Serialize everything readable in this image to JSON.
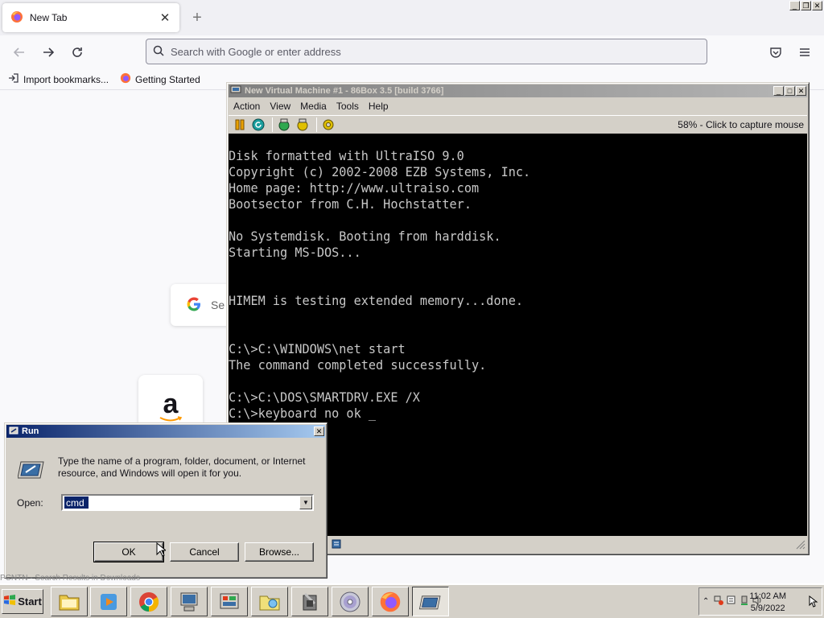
{
  "browser": {
    "tab_title": "New Tab",
    "url_placeholder": "Search with Google or enter address",
    "bookmarks": [
      "Import bookmarks...",
      "Getting Started"
    ],
    "google_partial": "Se",
    "amazon_letter": "a"
  },
  "vm": {
    "title": "New Virtual Machine #1 - 86Box 3.5 [build 3766]",
    "menus": [
      "Action",
      "View",
      "Media",
      "Tools",
      "Help"
    ],
    "capture_text": "58% - Click to capture mouse",
    "screen_lines": [
      "Disk formatted with UltraISO 9.0",
      "Copyright (c) 2002-2008 EZB Systems, Inc.",
      "Home page: http://www.ultraiso.com",
      "Bootsector from C.H. Hochstatter.",
      "",
      "No Systemdisk. Booting from harddisk.",
      "Starting MS-DOS...",
      "",
      "",
      "HIMEM is testing extended memory...done.",
      "",
      "",
      "C:\\>C:\\WINDOWS\\net start",
      "The command completed successfully.",
      "",
      "C:\\>C:\\DOS\\SMARTDRV.EXE /X",
      "C:\\>keyboard no ok _"
    ]
  },
  "run": {
    "title": "Run",
    "description": "Type the name of a program, folder, document, or Internet resource, and Windows will open it for you.",
    "open_label": "Open:",
    "open_value": "cmd",
    "ok_label": "OK",
    "cancel_label": "Cancel",
    "browse_label": "Browse..."
  },
  "behind_text": "PCNTN - Search Results in Downloads",
  "taskbar": {
    "start_label": "Start",
    "clock_time": "11:02 AM",
    "clock_date": "5/9/2022"
  }
}
